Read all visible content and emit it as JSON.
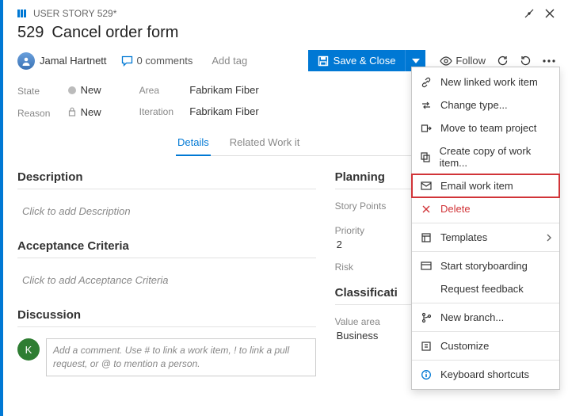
{
  "breadcrumb": {
    "type_label": "USER STORY 529*"
  },
  "window": {
    "restore_title": "Restore",
    "close_title": "Close"
  },
  "title": {
    "id": "529",
    "text": "Cancel order form"
  },
  "toolbar": {
    "assignee": "Jamal Hartnett",
    "comments_label": "0 comments",
    "add_tag": "Add tag",
    "save_label": "Save & Close",
    "follow_label": "Follow",
    "refresh_title": "Refresh",
    "revert_title": "Revert",
    "more_title": "More actions"
  },
  "fields": {
    "state_label": "State",
    "state_value": "New",
    "reason_label": "Reason",
    "reason_value": "New",
    "area_label": "Area",
    "area_value": "Fabrikam Fiber",
    "iteration_label": "Iteration",
    "iteration_value": "Fabrikam Fiber"
  },
  "tabs": {
    "details": "Details",
    "related": "Related Work it"
  },
  "left": {
    "description_h": "Description",
    "description_ph": "Click to add Description",
    "acceptance_h": "Acceptance Criteria",
    "acceptance_ph": "Click to add Acceptance Criteria",
    "discussion_h": "Discussion",
    "discussion_ph": "Add a comment. Use # to link a work item, ! to link a pull request, or @ to mention a person.",
    "disc_av": "K"
  },
  "right": {
    "planning_h": "Planning",
    "story_points_lbl": "Story Points",
    "priority_lbl": "Priority",
    "priority_val": "2",
    "risk_lbl": "Risk",
    "classification_h": "Classificati",
    "value_area_lbl": "Value area",
    "value_area_val": "Business"
  },
  "menu": {
    "new_linked": "New linked work item",
    "change_type": "Change type...",
    "move_project": "Move to team project",
    "create_copy": "Create copy of work item...",
    "email": "Email work item",
    "delete": "Delete",
    "templates": "Templates",
    "storyboarding": "Start storyboarding",
    "feedback": "Request feedback",
    "new_branch": "New branch...",
    "customize": "Customize",
    "shortcuts": "Keyboard shortcuts"
  }
}
